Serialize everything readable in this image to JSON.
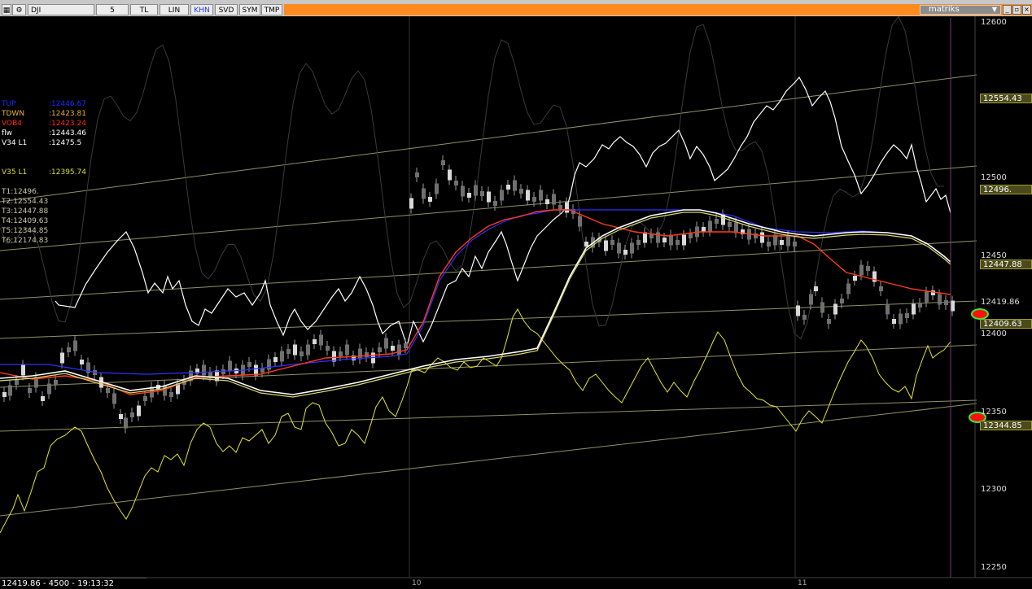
{
  "toolbar": {
    "symbol": "DJI",
    "interval": "5",
    "buttons": [
      "TL",
      "LIN",
      "KHN",
      "SVD",
      "SYM",
      "TMP"
    ],
    "active": "KHN",
    "brand": "matriks"
  },
  "legend": {
    "rows": [
      {
        "label": "TUP",
        "value": ":12446.67",
        "color": "#1c2bff"
      },
      {
        "label": "TDWN",
        "value": ":12423.81",
        "color": "#e8b430"
      },
      {
        "label": "VOB4",
        "value": ":12423.24",
        "color": "#ff2a1a"
      },
      {
        "label": "flw",
        "value": ":12443.46",
        "color": "#ffffff"
      },
      {
        "label": "V34 L1",
        "value": ":12475.5",
        "color": "#ffffff"
      },
      {
        "label": "V35 L1",
        "value": ":12395.74",
        "color": "#dede33"
      },
      {
        "label": "T1:12496.",
        "value": "",
        "color": "#c8c8a8"
      },
      {
        "label": "T2:12554.43",
        "value": "",
        "color": "#c8c8a8"
      },
      {
        "label": "T3:12447.88",
        "value": "",
        "color": "#c8c8a8"
      },
      {
        "label": "T4:12409.63",
        "value": "",
        "color": "#c8c8a8"
      },
      {
        "label": "T5:12344.85",
        "value": "",
        "color": "#c8c8a8"
      },
      {
        "label": "T6:12174.83",
        "value": "",
        "color": "#c8c8a8"
      }
    ]
  },
  "price_axis": {
    "ticks": [
      "12600",
      "12550",
      "12500",
      "12450",
      "12400",
      "12350",
      "12300",
      "12250"
    ],
    "boxes": [
      "12554.43",
      "12496.",
      "12447.88",
      "12409.63",
      "12344.85"
    ],
    "last_price": "12419.86"
  },
  "time_axis": {
    "labels": [
      "10",
      "11"
    ]
  },
  "status": {
    "text": "12419.86 - 4500 - 19:13:32"
  },
  "colors": {
    "background": "#000000",
    "channel": "#c2c28a",
    "ma_red": "#ff3a1a",
    "ma_blue": "#3030ff",
    "oscillator_white": "#ffffff",
    "oscillator_yellow": "#e6e62e",
    "marker": "#ff1010",
    "marker_ring": "#33ee33",
    "cursor": "#8a3a8a"
  },
  "chart_data": {
    "type": "candlestick",
    "y_range": [
      12250,
      12600
    ],
    "last_close": 12419.86
  }
}
